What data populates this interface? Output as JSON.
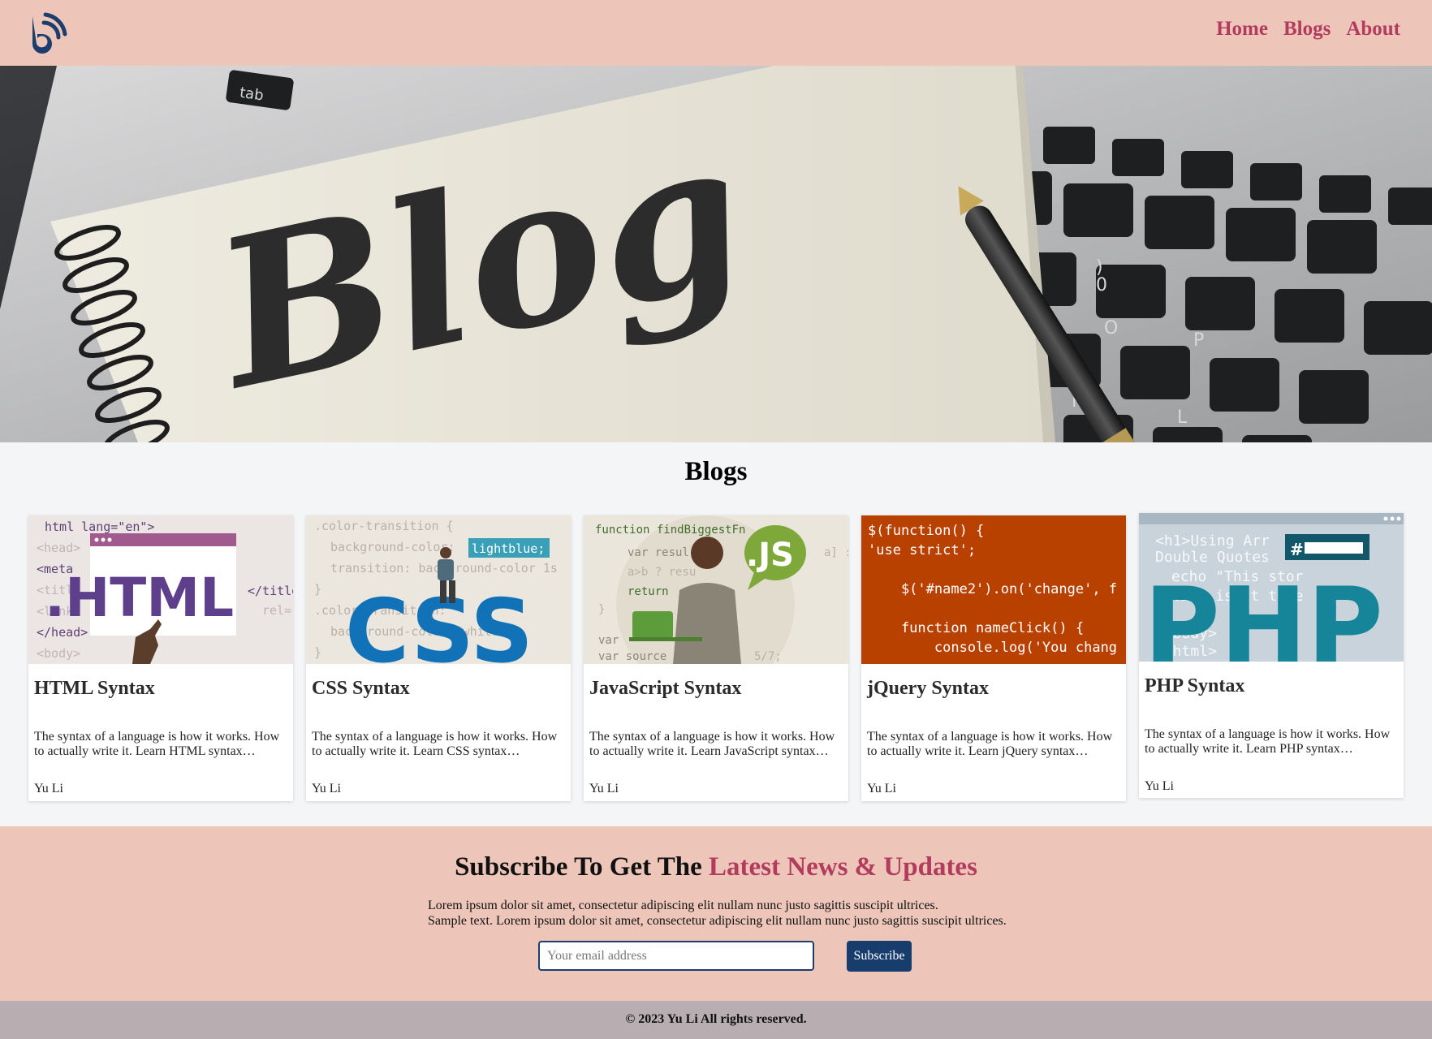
{
  "header": {
    "logo_icon": "blog-b-logo-icon",
    "nav": [
      "Home",
      "Blogs",
      "About"
    ]
  },
  "hero": {
    "image": "notebook-blog-laptop-photo",
    "notebook_text": "Blog"
  },
  "blogs": {
    "title": "Blogs",
    "cards": [
      {
        "title": "HTML Syntax",
        "desc": "The syntax of a language is how it works. How to actually write it. Learn HTML syntax…",
        "author": "Yu Li",
        "image": "html-illustration"
      },
      {
        "title": "CSS Syntax",
        "desc": "The syntax of a language is how it works. How to actually write it. Learn CSS syntax…",
        "author": "Yu Li",
        "image": "css-illustration"
      },
      {
        "title": "JavaScript Syntax",
        "desc": "The syntax of a language is how it works. How to actually write it. Learn JavaScript syntax…",
        "author": "Yu Li",
        "image": "javascript-illustration"
      },
      {
        "title": "jQuery Syntax",
        "desc": "The syntax of a language is how it works. How to actually write it. Learn jQuery syntax…",
        "author": "Yu Li",
        "image": "jquery-code-image"
      },
      {
        "title": "PHP Syntax",
        "desc": "The syntax of a language is how it works. How to actually write it. Learn PHP syntax…",
        "author": "Yu Li",
        "image": "php-illustration"
      }
    ]
  },
  "subscribe": {
    "title_plain": "Subscribe To Get The ",
    "title_accent": "Latest News & Updates",
    "text_line1": "Lorem ipsum dolor sit amet, consectetur adipiscing elit nullam nunc justo sagittis suscipit ultrices.",
    "text_line2": "Sample text. Lorem ipsum dolor sit amet, consectetur adipiscing elit nullam nunc justo sagittis suscipit ultrices.",
    "email_placeholder": "Your email address",
    "button": "Subscribe"
  },
  "footer": {
    "text": "© 2023 Yu Li All rights reserved."
  },
  "colors": {
    "header_bg": "#edc6b9",
    "accent": "#b23b5e",
    "button": "#173d6d",
    "footer_bg": "#b8aeb2"
  },
  "thumbnails": {
    "html": {
      "code": [
        "html lang=\"en\">",
        "<head>",
        "<meta",
        "<title",
        "<link",
        "</head>",
        "<body>"
      ],
      "logo": ".HTML",
      "tag": "</title",
      "rel": "rel="
    },
    "css": {
      "code": [
        ".color-transition {",
        "background-color:",
        "transition: background-color 1s",
        "}",
        ".color-transition:",
        "background-color: white",
        "}"
      ],
      "highlight": "lightblue;",
      "logo": "CSS"
    },
    "js": {
      "code_head": "function findBiggestFn",
      "code": [
        "var resul",
        "a>b ? resu",
        "return",
        "}",
        "var",
        "var source"
      ],
      "side": [
        "a] :",
        "5/7;"
      ],
      "logo": ".JS"
    },
    "jquery": {
      "code": [
        "$(function() {",
        "'use strict';",
        "",
        "    $('#name2').on('change', f",
        "",
        "    function nameClick() {",
        "        console.log('You chang"
      ]
    },
    "php": {
      "code": [
        "<h1>Using Arr",
        "Double Quotes",
        "echo \"This stor",
        "tion isn't ture",
        "</body>",
        "</html>"
      ],
      "hash": "#",
      "logo": "PHP"
    }
  }
}
